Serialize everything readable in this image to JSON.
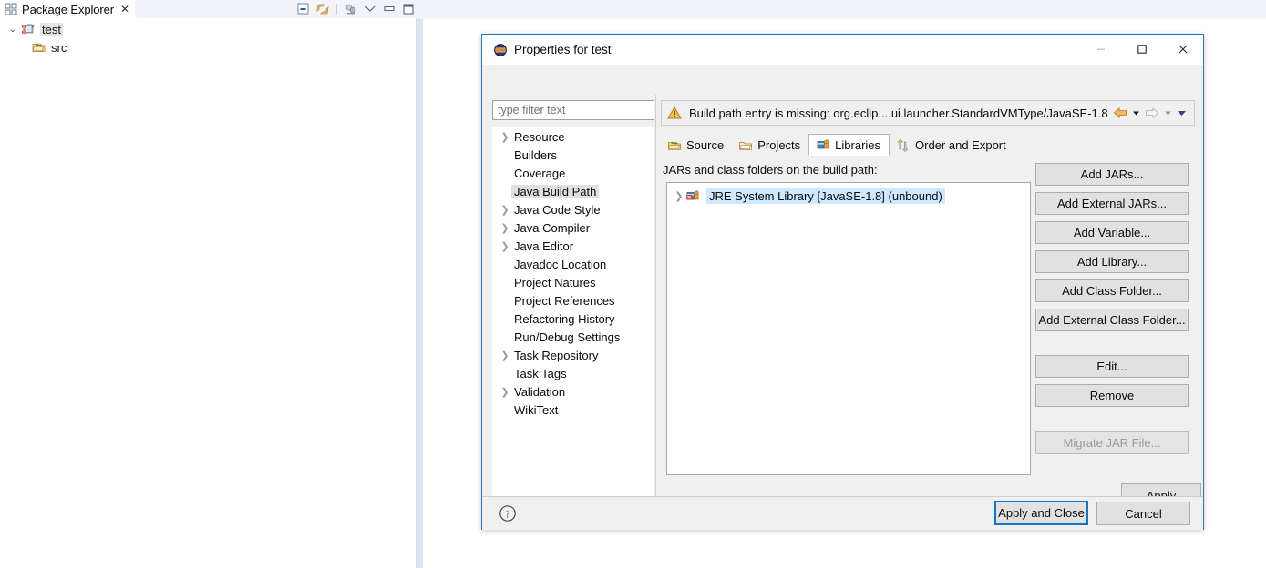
{
  "workbench": {
    "package_explorer": {
      "tab_label": "Package Explorer",
      "close_glyph": "✕",
      "toolbar": [
        {
          "name": "collapse-all-icon",
          "title": "Collapse All"
        },
        {
          "name": "link-with-editor-icon",
          "title": "Link with Editor"
        },
        {
          "name": "view-menu-icon",
          "title": "View Menu"
        },
        {
          "name": "minimize-icon",
          "title": "Minimize"
        },
        {
          "name": "maximize-icon",
          "title": "Maximize"
        }
      ],
      "tree": [
        {
          "label": "test",
          "twisty": "⌄",
          "icon": "java-project-error-icon",
          "selected": true,
          "indent": 0
        },
        {
          "label": "src",
          "twisty": "",
          "icon": "source-folder-icon",
          "selected": false,
          "indent": 1
        }
      ]
    }
  },
  "dialog": {
    "title": "Properties for test",
    "app_icon": "eclipse-globe-icon",
    "window_controls": [
      {
        "name": "minimize-button",
        "glyph": "–"
      },
      {
        "name": "maximize-button",
        "glyph": "☐"
      },
      {
        "name": "close-button",
        "glyph": "✕"
      }
    ],
    "filter": {
      "placeholder": "type filter text",
      "value": ""
    },
    "nav_items": [
      {
        "label": "Resource",
        "expandable": true,
        "selected": false
      },
      {
        "label": "Builders",
        "expandable": false,
        "selected": false
      },
      {
        "label": "Coverage",
        "expandable": false,
        "selected": false
      },
      {
        "label": "Java Build Path",
        "expandable": false,
        "selected": true
      },
      {
        "label": "Java Code Style",
        "expandable": true,
        "selected": false
      },
      {
        "label": "Java Compiler",
        "expandable": true,
        "selected": false
      },
      {
        "label": "Java Editor",
        "expandable": true,
        "selected": false
      },
      {
        "label": "Javadoc Location",
        "expandable": false,
        "selected": false
      },
      {
        "label": "Project Natures",
        "expandable": false,
        "selected": false
      },
      {
        "label": "Project References",
        "expandable": false,
        "selected": false
      },
      {
        "label": "Refactoring History",
        "expandable": false,
        "selected": false
      },
      {
        "label": "Run/Debug Settings",
        "expandable": false,
        "selected": false
      },
      {
        "label": "Task Repository",
        "expandable": true,
        "selected": false
      },
      {
        "label": "Task Tags",
        "expandable": false,
        "selected": false
      },
      {
        "label": "Validation",
        "expandable": true,
        "selected": false
      },
      {
        "label": "WikiText",
        "expandable": false,
        "selected": false
      }
    ],
    "message": {
      "text": "Build path entry is missing: org.eclip....ui.launcher.StandardVMType/JavaSE-1.8",
      "icon": "warning-icon",
      "severity": "warning",
      "severity_color": "#f0a732"
    },
    "nav_arrows": [
      {
        "name": "back-arrow-icon",
        "enabled": true,
        "color": "#e8a33d"
      },
      {
        "name": "back-dropdown-icon",
        "enabled": true,
        "color": "#1a1a1a"
      },
      {
        "name": "forward-arrow-icon",
        "enabled": false,
        "color": "#bdbdbd"
      },
      {
        "name": "forward-dropdown-icon",
        "enabled": false,
        "color": "#9b9b9b"
      },
      {
        "name": "history-dropdown-icon",
        "enabled": true,
        "color": "#5b2d8e"
      }
    ],
    "tabs": [
      {
        "label": "Source",
        "icon": "source-folder-icon",
        "active": false
      },
      {
        "label": "Projects",
        "icon": "project-folder-icon",
        "active": false
      },
      {
        "label": "Libraries",
        "icon": "libraries-books-icon",
        "active": true
      },
      {
        "label": "Order and Export",
        "icon": "order-export-icon",
        "active": false
      }
    ],
    "libraries": {
      "list_label": "JARs and class folders on the build path:",
      "entries": [
        {
          "label": "JRE System Library [JavaSE-1.8] (unbound)",
          "icon": "jre-library-error-icon",
          "expandable": true,
          "selected": true
        }
      ]
    },
    "side_buttons": [
      {
        "label": "Add JARs...",
        "enabled": true,
        "group": 1
      },
      {
        "label": "Add External JARs...",
        "enabled": true,
        "group": 1
      },
      {
        "label": "Add Variable...",
        "enabled": true,
        "group": 1
      },
      {
        "label": "Add Library...",
        "enabled": true,
        "group": 1
      },
      {
        "label": "Add Class Folder...",
        "enabled": true,
        "group": 1
      },
      {
        "label": "Add External Class Folder...",
        "enabled": true,
        "group": 1
      },
      {
        "label": "Edit...",
        "enabled": true,
        "group": 2
      },
      {
        "label": "Remove",
        "enabled": true,
        "group": 2
      },
      {
        "label": "Migrate JAR File...",
        "enabled": false,
        "group": 3
      }
    ],
    "apply_label": "Apply",
    "footer": {
      "help_icon": "help-question-icon",
      "apply_and_close_label": "Apply and Close",
      "cancel_label": "Cancel"
    }
  }
}
